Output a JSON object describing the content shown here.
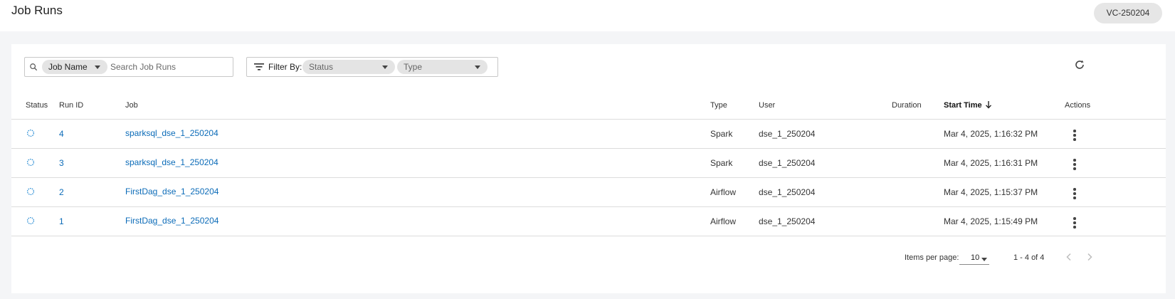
{
  "header": {
    "title": "Job Runs",
    "virtual_cluster": "VC-250204"
  },
  "search": {
    "field_chip": "Job Name",
    "placeholder": "Search Job Runs",
    "value": ""
  },
  "filter": {
    "label": "Filter By:",
    "status_placeholder": "Status",
    "type_placeholder": "Type"
  },
  "table": {
    "columns": {
      "status": "Status",
      "run_id": "Run ID",
      "job": "Job",
      "type": "Type",
      "user": "User",
      "duration": "Duration",
      "start_time": "Start Time",
      "actions": "Actions"
    },
    "sort": {
      "column": "start_time",
      "direction": "descending"
    },
    "rows": [
      {
        "status": "running",
        "run_id": "4",
        "job": "sparksql_dse_1_250204",
        "type": "Spark",
        "user": "dse_1_250204",
        "duration": "",
        "start_time": "Mar 4, 2025, 1:16:32 PM"
      },
      {
        "status": "running",
        "run_id": "3",
        "job": "sparksql_dse_1_250204",
        "type": "Spark",
        "user": "dse_1_250204",
        "duration": "",
        "start_time": "Mar 4, 2025, 1:16:31 PM"
      },
      {
        "status": "running",
        "run_id": "2",
        "job": "FirstDag_dse_1_250204",
        "type": "Airflow",
        "user": "dse_1_250204",
        "duration": "",
        "start_time": "Mar 4, 2025, 1:15:37 PM"
      },
      {
        "status": "running",
        "run_id": "1",
        "job": "FirstDag_dse_1_250204",
        "type": "Airflow",
        "user": "dse_1_250204",
        "duration": "",
        "start_time": "Mar 4, 2025, 1:15:49 PM"
      }
    ]
  },
  "pagination": {
    "items_per_page_label": "Items per page:",
    "items_per_page": "10",
    "range": "1 - 4 of 4"
  },
  "icons": {
    "search": "search-icon",
    "filter": "filter-list-icon",
    "refresh": "refresh-icon",
    "sort": "arrow-down-icon",
    "status": "spinner-icon",
    "actions": "more-vert-icon",
    "prev": "chevron-left-icon",
    "next": "chevron-right-icon"
  },
  "colors": {
    "link": "#0b6bb8",
    "spinner": "#2d8fd5",
    "background": "#f4f5f7"
  }
}
